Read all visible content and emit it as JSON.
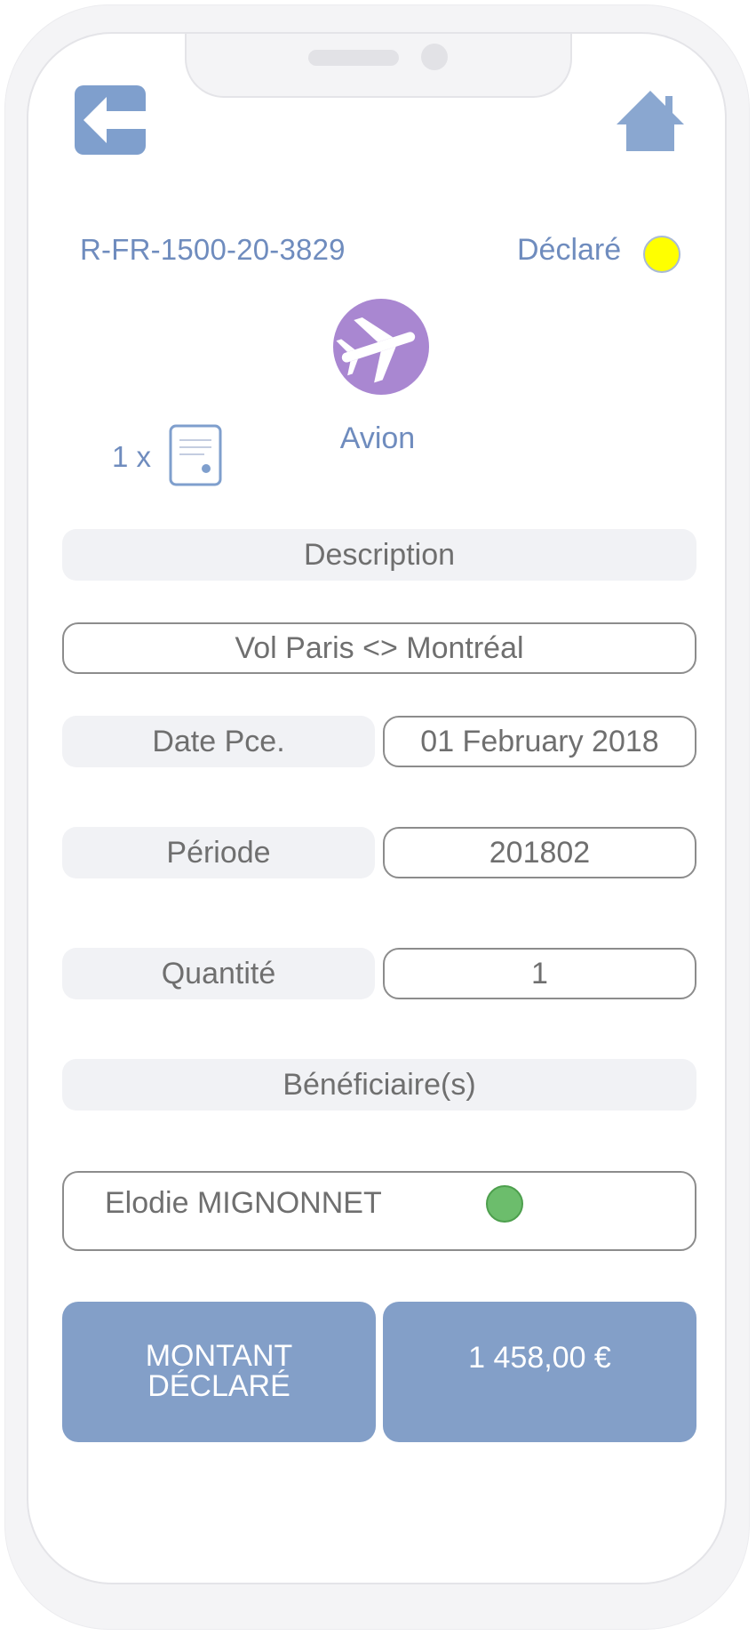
{
  "header": {
    "back_icon": "back-arrow-icon",
    "home_icon": "home-icon"
  },
  "record": {
    "reference": "R-FR-1500-20-3829",
    "status_label": "Déclaré",
    "status_color": "#ffff00"
  },
  "category": {
    "icon": "airplane-icon",
    "label": "Avion",
    "color": "#a987d1"
  },
  "attachments": {
    "count_label": "1 x",
    "icon": "document-icon"
  },
  "fields": {
    "description_label": "Description",
    "description_value": "Vol Paris <> Montréal",
    "date_label": "Date Pce.",
    "date_value": "01 February 2018",
    "period_label": "Période",
    "period_value": "201802",
    "quantity_label": "Quantité",
    "quantity_value": "1",
    "beneficiaries_label": "Bénéficiaire(s)"
  },
  "beneficiaries": [
    {
      "name": "Elodie MIGNONNET",
      "status_color": "#6cbd6c"
    }
  ],
  "amount": {
    "label_line1": "MONTANT",
    "label_line2": "DÉCLARÉ",
    "value": "1 458,00 €"
  },
  "colors": {
    "accent": "#839fc8",
    "text_blue": "#6f8cbe"
  }
}
